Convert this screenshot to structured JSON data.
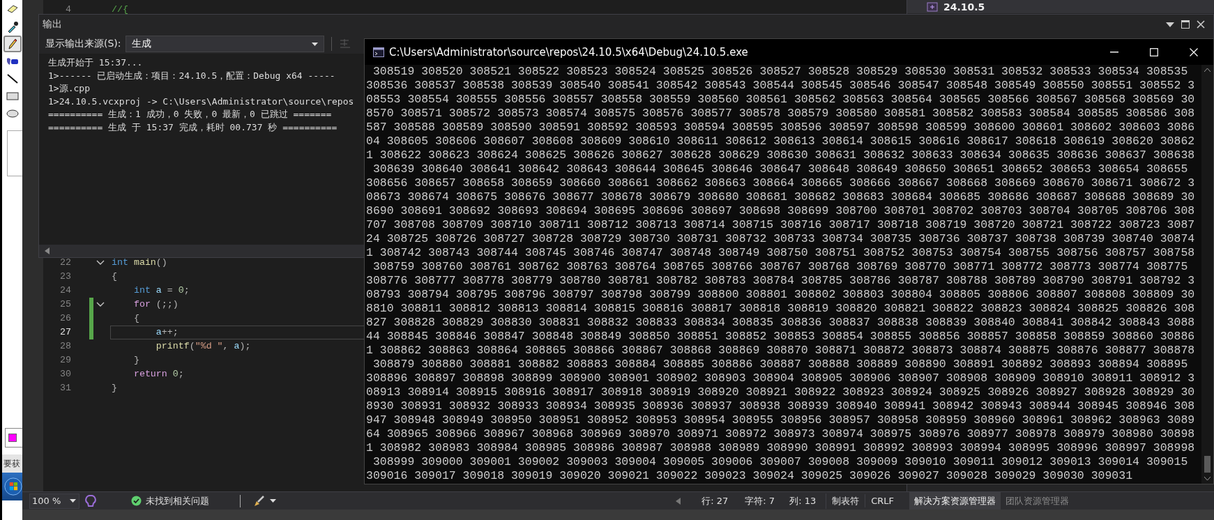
{
  "paint_toolbox": {
    "tools": [
      {
        "kind": "eraser",
        "selected": false
      },
      {
        "kind": "picker",
        "selected": false
      },
      {
        "kind": "pencil",
        "selected": true
      },
      {
        "kind": "brush",
        "selected": false
      },
      {
        "kind": "line",
        "selected": false
      },
      {
        "kind": "rectangle",
        "selected": false
      },
      {
        "kind": "ellipse",
        "selected": false
      }
    ],
    "color_swatch": {
      "color": "#ff00ff"
    },
    "hint_text": "要获"
  },
  "editor": {
    "top_lines": [
      {
        "number": "4",
        "tokens": [
          {
            "text": "//{",
            "kind": "comment"
          }
        ]
      }
    ],
    "lines": [
      {
        "number": "22",
        "changed": false,
        "current": false,
        "foldable": true,
        "tokens": [
          {
            "text": "int",
            "kind": "type"
          },
          {
            "text": " main",
            "kind": "function"
          },
          {
            "text": "()",
            "kind": "plain"
          }
        ]
      },
      {
        "number": "23",
        "changed": false,
        "current": false,
        "foldable": false,
        "tokens": [
          {
            "text": "{",
            "kind": "plain"
          }
        ]
      },
      {
        "number": "24",
        "changed": false,
        "current": false,
        "foldable": false,
        "tokens": [
          {
            "text": "    int",
            "kind": "type"
          },
          {
            "text": " a",
            "kind": "variable"
          },
          {
            "text": " = ",
            "kind": "plain"
          },
          {
            "text": "0",
            "kind": "number"
          },
          {
            "text": ";",
            "kind": "plain"
          }
        ]
      },
      {
        "number": "25",
        "changed": true,
        "current": false,
        "foldable": true,
        "tokens": [
          {
            "text": "    for",
            "kind": "keyword"
          },
          {
            "text": " (;;)",
            "kind": "plain"
          }
        ]
      },
      {
        "number": "26",
        "changed": true,
        "current": false,
        "foldable": false,
        "tokens": [
          {
            "text": "    {",
            "kind": "plain"
          }
        ]
      },
      {
        "number": "27",
        "changed": true,
        "current": true,
        "foldable": false,
        "tokens": [
          {
            "text": "        a",
            "kind": "variable"
          },
          {
            "text": "++;",
            "kind": "plain"
          }
        ]
      },
      {
        "number": "28",
        "changed": false,
        "current": false,
        "foldable": false,
        "tokens": [
          {
            "text": "        printf",
            "kind": "function"
          },
          {
            "text": "(",
            "kind": "plain"
          },
          {
            "text": "\"%d \"",
            "kind": "string"
          },
          {
            "text": ", ",
            "kind": "plain"
          },
          {
            "text": "a",
            "kind": "variable"
          },
          {
            "text": ");",
            "kind": "plain"
          }
        ]
      },
      {
        "number": "29",
        "changed": false,
        "current": false,
        "foldable": false,
        "tokens": [
          {
            "text": "    }",
            "kind": "plain"
          }
        ]
      },
      {
        "number": "30",
        "changed": false,
        "current": false,
        "foldable": false,
        "tokens": [
          {
            "text": "    return",
            "kind": "keyword"
          },
          {
            "text": " 0",
            "kind": "number"
          },
          {
            "text": ";",
            "kind": "plain"
          }
        ]
      },
      {
        "number": "31",
        "changed": false,
        "current": false,
        "foldable": false,
        "tokens": [
          {
            "text": "}",
            "kind": "plain"
          }
        ]
      }
    ]
  },
  "solution_explorer": {
    "project": "24.10.5"
  },
  "output_panel": {
    "title": "输出",
    "source_label": "显示输出来源(S):",
    "source_value": "生成",
    "lines": [
      "生成开始于 15:37...",
      "1>------ 已启动生成：项目：24.10.5，配置：Debug x64 -----",
      "1>源.cpp",
      "1>24.10.5.vcxproj -> C:\\Users\\Administrator\\source\\repos",
      "========== 生成：1 成功，0 失败，0 最新，0 已跳过 =======",
      "========== 生成 于 15:37 完成，耗时 00.737 秒 =========="
    ]
  },
  "console_window": {
    "title": "C:\\Users\\Administrator\\source\\repos\\24.10.5\\x64\\Debug\\24.10.5.exe",
    "lines": [
      " 308519 308520 308521 308522 308523 308524 308525 308526 308527 308528 308529 308530 308531 308532 308533 308534 308535",
      "308536 308537 308538 308539 308540 308541 308542 308543 308544 308545 308546 308547 308548 308549 308550 308551 308552 3",
      "08553 308554 308555 308556 308557 308558 308559 308560 308561 308562 308563 308564 308565 308566 308567 308568 308569 30",
      "8570 308571 308572 308573 308574 308575 308576 308577 308578 308579 308580 308581 308582 308583 308584 308585 308586 308",
      "587 308588 308589 308590 308591 308592 308593 308594 308595 308596 308597 308598 308599 308600 308601 308602 308603 3086",
      "04 308605 308606 308607 308608 308609 308610 308611 308612 308613 308614 308615 308616 308617 308618 308619 308620 30862",
      "1 308622 308623 308624 308625 308626 308627 308628 308629 308630 308631 308632 308633 308634 308635 308636 308637 308638",
      " 308639 308640 308641 308642 308643 308644 308645 308646 308647 308648 308649 308650 308651 308652 308653 308654 308655",
      "308656 308657 308658 308659 308660 308661 308662 308663 308664 308665 308666 308667 308668 308669 308670 308671 308672 3",
      "08673 308674 308675 308676 308677 308678 308679 308680 308681 308682 308683 308684 308685 308686 308687 308688 308689 30",
      "8690 308691 308692 308693 308694 308695 308696 308697 308698 308699 308700 308701 308702 308703 308704 308705 308706 308",
      "707 308708 308709 308710 308711 308712 308713 308714 308715 308716 308717 308718 308719 308720 308721 308722 308723 3087",
      "24 308725 308726 308727 308728 308729 308730 308731 308732 308733 308734 308735 308736 308737 308738 308739 308740 30874",
      "1 308742 308743 308744 308745 308746 308747 308748 308749 308750 308751 308752 308753 308754 308755 308756 308757 308758",
      " 308759 308760 308761 308762 308763 308764 308765 308766 308767 308768 308769 308770 308771 308772 308773 308774 308775",
      "308776 308777 308778 308779 308780 308781 308782 308783 308784 308785 308786 308787 308788 308789 308790 308791 308792 3",
      "08793 308794 308795 308796 308797 308798 308799 308800 308801 308802 308803 308804 308805 308806 308807 308808 308809 30",
      "8810 308811 308812 308813 308814 308815 308816 308817 308818 308819 308820 308821 308822 308823 308824 308825 308826 308",
      "827 308828 308829 308830 308831 308832 308833 308834 308835 308836 308837 308838 308839 308840 308841 308842 308843 3088",
      "44 308845 308846 308847 308848 308849 308850 308851 308852 308853 308854 308855 308856 308857 308858 308859 308860 30886",
      "1 308862 308863 308864 308865 308866 308867 308868 308869 308870 308871 308872 308873 308874 308875 308876 308877 308878",
      " 308879 308880 308881 308882 308883 308884 308885 308886 308887 308888 308889 308890 308891 308892 308893 308894 308895",
      "308896 308897 308898 308899 308900 308901 308902 308903 308904 308905 308906 308907 308908 308909 308910 308911 308912 3",
      "08913 308914 308915 308916 308917 308918 308919 308920 308921 308922 308923 308924 308925 308926 308927 308928 308929 30",
      "8930 308931 308932 308933 308934 308935 308936 308937 308938 308939 308940 308941 308942 308943 308944 308945 308946 308",
      "947 308948 308949 308950 308951 308952 308953 308954 308955 308956 308957 308958 308959 308960 308961 308962 308963 3089",
      "64 308965 308966 308967 308968 308969 308970 308971 308972 308973 308974 308975 308976 308977 308978 308979 308980 30898",
      "1 308982 308983 308984 308985 308986 308987 308988 308989 308990 308991 308992 308993 308994 308995 308996 308997 308998",
      " 308999 309000 309001 309002 309003 309004 309005 309006 309007 309008 309009 309010 309011 309012 309013 309014 309015",
      "309016 309017 309018 309019 309020 309021 309022 309023 309024 309025 309026 309027 309028 309029 309030 309031"
    ]
  },
  "status_bar": {
    "zoom": "100 %",
    "issues": "未找到相关问题",
    "line": "行: 27",
    "char": "字符: 7",
    "column": "列: 13",
    "tab_mode": "制表符",
    "line_ending": "CRLF",
    "tabs": [
      {
        "label": "解决方案资源管理器",
        "selected": true
      },
      {
        "label": "团队资源管理器",
        "selected": false
      }
    ]
  }
}
